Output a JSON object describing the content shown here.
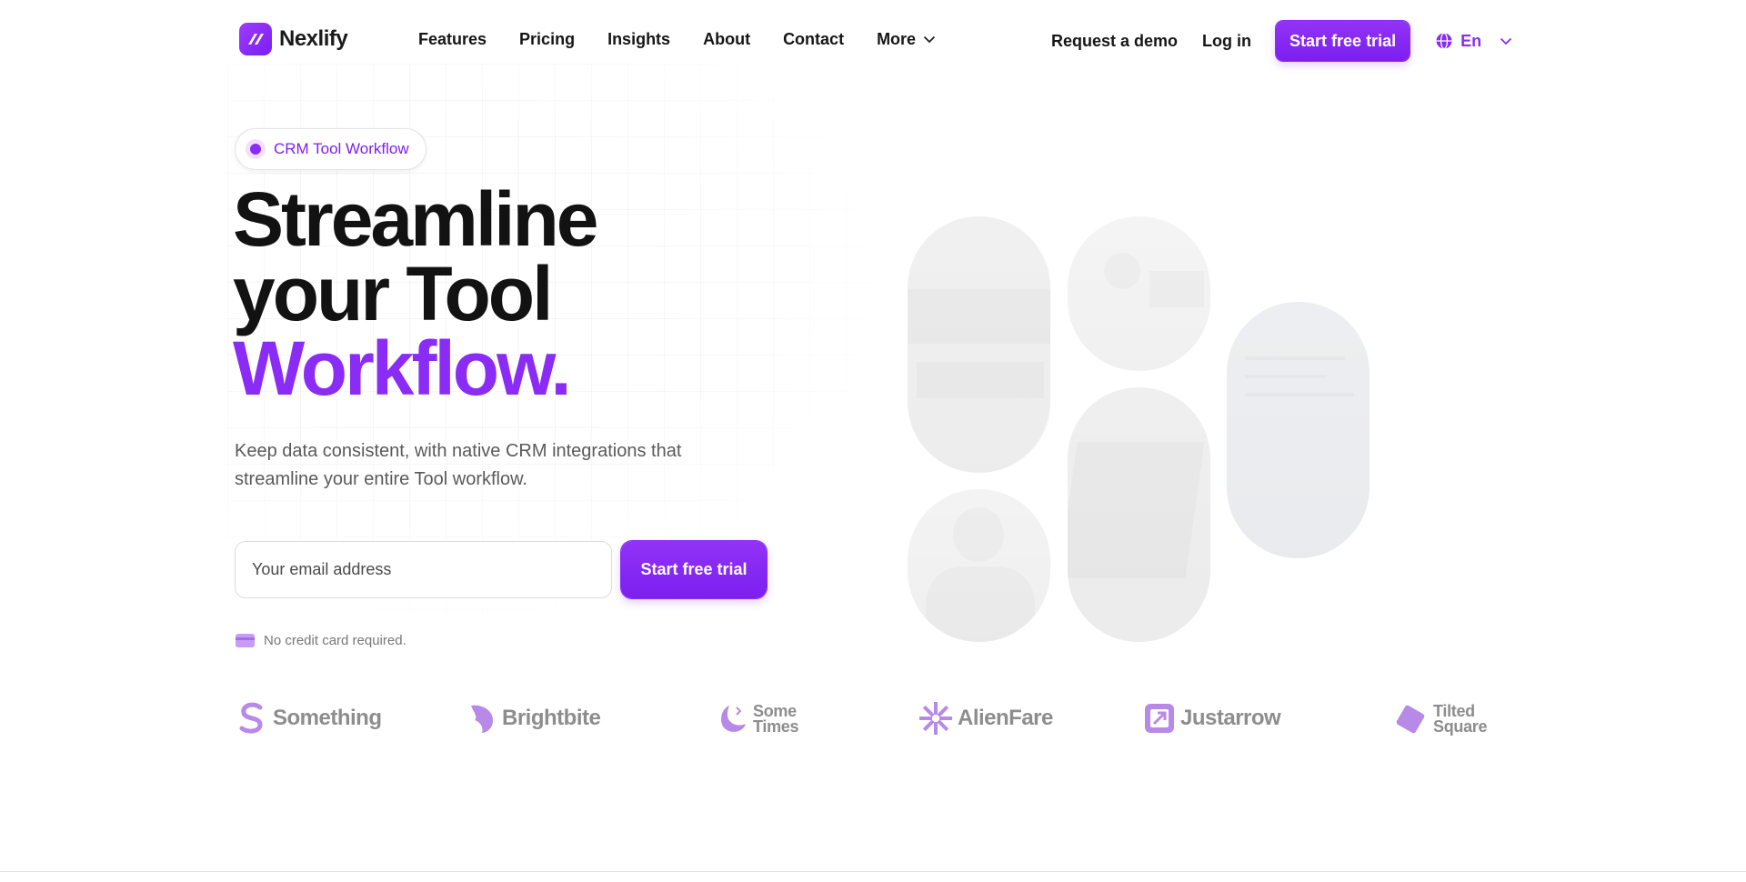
{
  "nav": {
    "brand": "Nexlify",
    "links": [
      "Features",
      "Pricing",
      "Insights",
      "About",
      "Contact"
    ],
    "more_label": "More",
    "request_demo": "Request a demo",
    "login": "Log in",
    "cta": "Start free trial",
    "language": "En"
  },
  "hero": {
    "badge": "CRM Tool Workflow",
    "headline_line1": "Streamline",
    "headline_line2": "your Tool",
    "headline_accent": "Workflow.",
    "subtext": "Keep data consistent, with native CRM integrations that streamline your entire Tool workflow.",
    "email_placeholder": "Your email address",
    "cta": "Start free trial",
    "note": "No credit card required."
  },
  "logos": [
    {
      "name": "Something",
      "icon": "s-swirl-icon"
    },
    {
      "name": "Brightbite",
      "icon": "bite-icon"
    },
    {
      "name": "Some Times",
      "line1": "Some",
      "line2": "Times",
      "icon": "crescent-icon"
    },
    {
      "name": "AlienFare",
      "icon": "burst-icon"
    },
    {
      "name": "Justarrow",
      "icon": "arrow-box-icon"
    },
    {
      "name": "Tilted Square",
      "line1": "Tilted",
      "line2": "Square",
      "icon": "tilted-square-icon"
    }
  ],
  "colors": {
    "accent": "#8a2cf5",
    "text": "#121212",
    "muted": "#5a5a5a",
    "logo_gray": "#8d8d8d",
    "logo_purple": "#b88ae8"
  }
}
